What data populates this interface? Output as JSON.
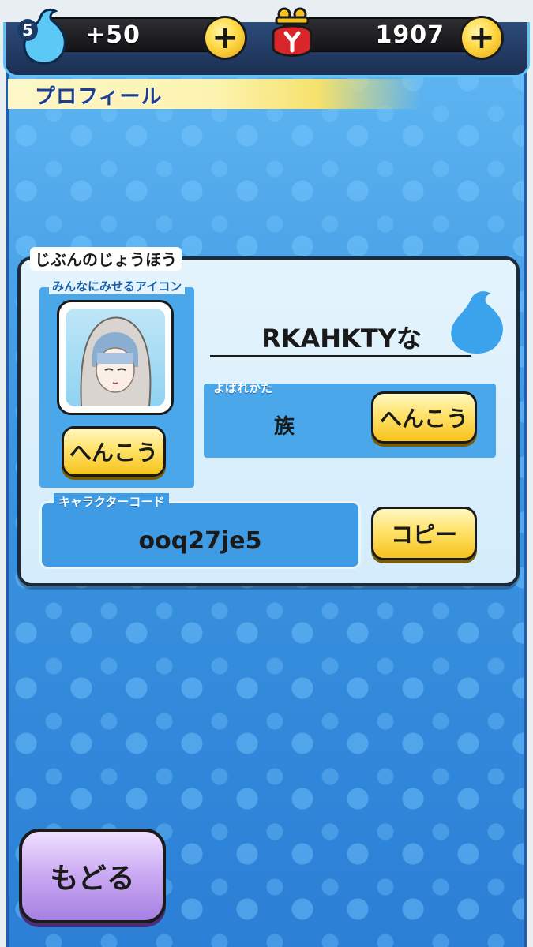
{
  "topbar": {
    "orb_count": "5",
    "stamina": "+50",
    "money": "1907"
  },
  "header": {
    "title": "プロフィール"
  },
  "profile": {
    "section_label": "じぶんのじょうほう",
    "icon_label": "みんなにみせるアイコン",
    "icon_change_label": "へんこう",
    "player_name": "RKAHKTYな",
    "title_label": "よばれかた",
    "title_value": "族",
    "title_change_label": "へんこう",
    "code_label": "キャラクターコード",
    "code_value": "ooq27je5",
    "copy_label": "コピー"
  },
  "footer": {
    "back_label": "もどる"
  }
}
